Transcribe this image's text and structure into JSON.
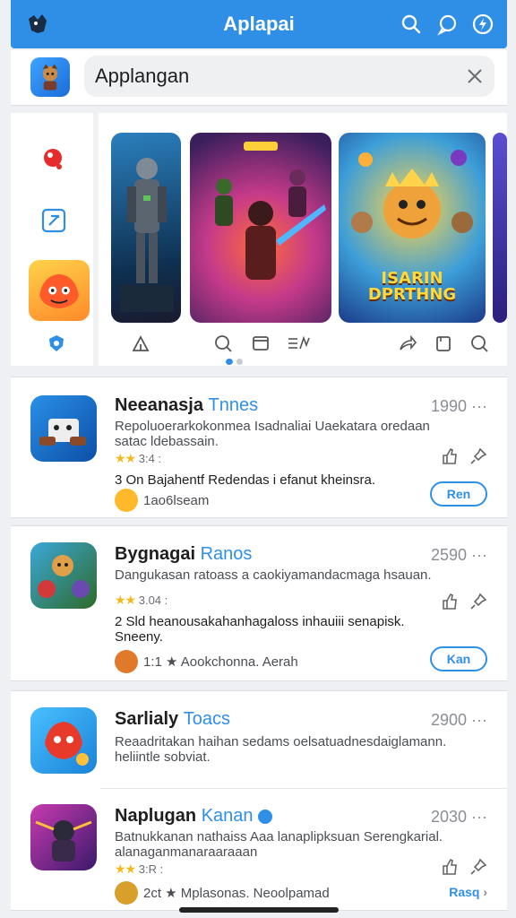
{
  "header": {
    "title": "Aplapai",
    "icons": [
      "app-logo-icon",
      "search-icon",
      "chat-icon",
      "lightning-icon"
    ]
  },
  "search": {
    "value": "Applangan",
    "placeholder": ""
  },
  "hero": {
    "sidebar_icons": [
      "red-pin-icon",
      "arrow-box-icon",
      "game-tile-icon",
      "shield-icon"
    ],
    "banners": [
      {
        "tag": ""
      },
      {
        "tag": ""
      },
      {
        "tag": "ISARIN DPRTHNG"
      },
      {
        "tag": ""
      }
    ],
    "tab_icons": [
      "home-icon",
      "search-icon",
      "folder-icon",
      "list-icon",
      "share-icon",
      "copy-icon",
      "search-icon"
    ]
  },
  "apps": [
    {
      "name": "Neeanasja",
      "name_accent": "Tnnes",
      "number": "1990",
      "desc": "Repoluoerarkokonmea Isadnaliai Uaekatara oredaan satac ldebassain.",
      "rating": "3:4 :",
      "line3": "3  On Bajahentf Redendas i efanut kheinsra.",
      "sub": "1ao6lseam",
      "get_label": "Ren"
    },
    {
      "name": "Bygnagai",
      "name_accent": "Ranos",
      "number": "2590",
      "desc": "Dangukasan ratoass a caokiyamandacmaga hsauan.",
      "rating": "3.04 :",
      "line3": "2   Sld heanousakahanhagaloss  inhauiii senapisk. Sneeny.",
      "sub": "1:1 ★ Aookchonna. Aerah",
      "get_label": "Kan"
    },
    {
      "name": "Sarlialy",
      "name_accent": "Toacs",
      "number": "2900",
      "desc": "Reaadritakan haihan sedams oelsatuadnesdaiglamann. heliintle sobviat.",
      "rating": "",
      "line3": "",
      "sub": "",
      "get_label": ""
    },
    {
      "name": "Naplugan",
      "name_accent": "Kanan",
      "number": "2030",
      "desc": "Batnukkanan nathaiss Aaa lanaplipksuan Serengkarial. alanaganmanaraaraaan",
      "rating": "3:R :",
      "line3": "",
      "sub": "2ct ★ Mplasonas. Neoolpamad",
      "get_label": "Rasq"
    }
  ],
  "colors": {
    "accent": "#2f8fe6",
    "star": "#f5b81c",
    "background": "#eef0f3"
  }
}
